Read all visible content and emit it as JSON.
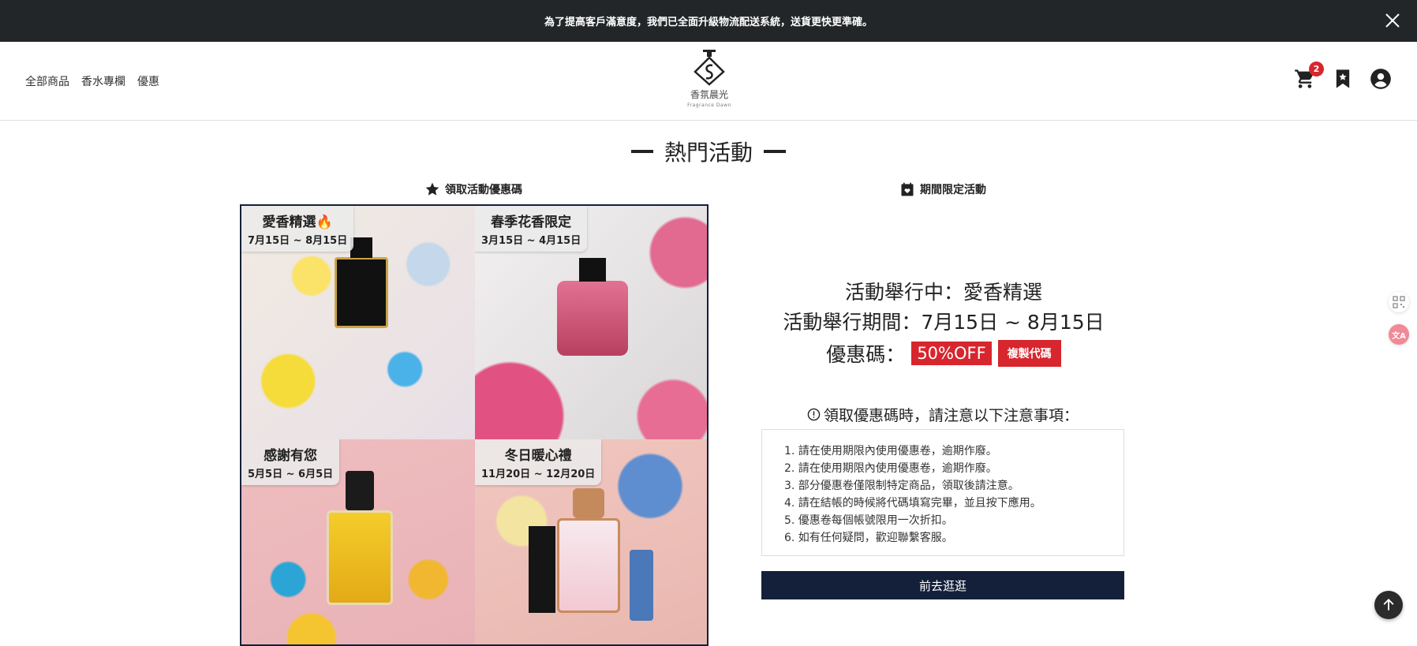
{
  "announcement": {
    "text": "為了提高客戶滿意度，我們已全面升級物流配送系統，送貨更快更準確。"
  },
  "nav": {
    "items": [
      "全部商品",
      "香水專欄",
      "優惠"
    ]
  },
  "logo": {
    "name": "香氛晨光",
    "subtitle": "Fragrance Dawn"
  },
  "cart": {
    "count": "2"
  },
  "section": {
    "title": "熱門活動"
  },
  "tabs": {
    "coupons": "領取活動優惠碼",
    "limited": "期間限定活動"
  },
  "campaigns": [
    {
      "name": "愛香精選",
      "date": "7月15日 ~ 8月15日"
    },
    {
      "name": "春季花香限定",
      "date": "3月15日 ~ 4月15日"
    },
    {
      "name": "感謝有您",
      "date": "5月5日 ~ 6月5日"
    },
    {
      "name": "冬日暖心禮",
      "date": "11月20日 ~ 12月20日"
    }
  ],
  "promo": {
    "current": "活動舉行中：愛香精選",
    "period": "活動舉行期間：7月15日 ~ 8月15日",
    "code_label": "優惠碼：",
    "code": "50%OFF",
    "copy_label": "複製代碼"
  },
  "notice": {
    "heading": "領取優惠碼時，請注意以下注意事項：",
    "items": [
      "1. 請在使用期限內使用優惠卷，逾期作廢。",
      "2. 請在使用期限內使用優惠卷，逾期作廢。",
      "3. 部分優惠卷僅限制特定商品，領取後請注意。",
      "4. 請在結帳的時候將代碼填寫完畢，並且按下應用。",
      "5. 優惠卷每個帳號限用一次折扣。",
      "6. 如有任何疑問，歡迎聯繫客服。"
    ]
  },
  "cta": {
    "label": "前去逛逛"
  },
  "side": {
    "translate_label": "文A"
  },
  "colors": {
    "accent_red": "#d7262d",
    "navy": "#14203a",
    "announce_bg": "#232628"
  }
}
